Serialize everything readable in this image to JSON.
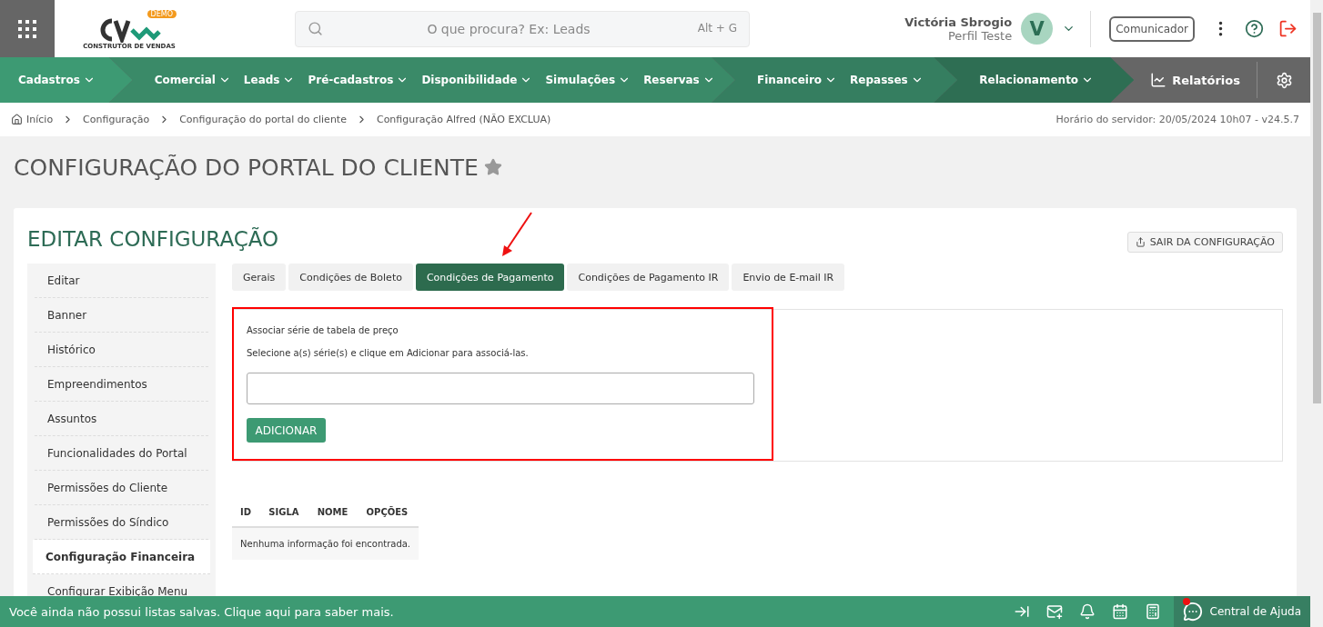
{
  "header": {
    "logo_badge": "DEMO",
    "logo_tagline": "CONSTRUTOR DE VENDAS",
    "search": {
      "placeholder": "O que procura? Ex: Leads",
      "shortcut": "Alt + G"
    },
    "user": {
      "name": "Victória Sbrogio",
      "profile": "Perfil Teste",
      "initial": "V"
    },
    "communicator": "Comunicador"
  },
  "nav": {
    "groups": [
      {
        "items": [
          "Cadastros"
        ]
      },
      {
        "items": [
          "Comercial",
          "Leads",
          "Pré-cadastros",
          "Disponibilidade",
          "Simulações",
          "Reservas"
        ]
      },
      {
        "items": [
          "Financeiro",
          "Repasses"
        ]
      },
      {
        "items": [
          "Relacionamento"
        ]
      }
    ],
    "reports": "Relatórios"
  },
  "breadcrumb": {
    "items": [
      "Início",
      "Configuração",
      "Configuração do portal do cliente",
      "Configuração Alfred (NÃO EXCLUA)"
    ],
    "server_time": "Horário do servidor: 20/05/2024 10h07 - v24.5.7"
  },
  "page_title": "CONFIGURAÇÃO DO PORTAL DO CLIENTE",
  "favorite": false,
  "card": {
    "title": "EDITAR CONFIGURAÇÃO",
    "exit_button": "SAIR DA CONFIGURAÇÃO",
    "sidebar": [
      {
        "label": "Editar",
        "selected": false
      },
      {
        "label": "Banner",
        "selected": false
      },
      {
        "label": "Histórico",
        "selected": false
      },
      {
        "label": "Empreendimentos",
        "selected": false
      },
      {
        "label": "Assuntos",
        "selected": false
      },
      {
        "label": "Funcionalidades do Portal",
        "selected": false
      },
      {
        "label": "Permissões do Cliente",
        "selected": false
      },
      {
        "label": "Permissões do Síndico",
        "selected": false
      },
      {
        "label": "Configuração Financeira",
        "selected": true
      },
      {
        "label": "Configurar Exibição Menu",
        "selected": false
      }
    ],
    "tabs": [
      {
        "label": "Gerais",
        "selected": false
      },
      {
        "label": "Condições de Boleto",
        "selected": false
      },
      {
        "label": "Condições de Pagamento",
        "selected": true
      },
      {
        "label": "Condições de Pagamento IR",
        "selected": false
      },
      {
        "label": "Envio de E-mail IR",
        "selected": false
      }
    ],
    "form": {
      "heading": "Associar série de tabela de preço",
      "hint": "Selecione a(s) série(s) e clique em Adicionar para associá-las.",
      "button": "ADICIONAR"
    },
    "table": {
      "columns": [
        "ID",
        "SIGLA",
        "NOME",
        "OPÇÕES"
      ],
      "empty": "Nenhuma informação foi encontrada."
    }
  },
  "footer": {
    "message": "Você ainda não possui listas salvas. Clique aqui para saber mais.",
    "help": "Central de Ajuda",
    "help_notification": true
  }
}
